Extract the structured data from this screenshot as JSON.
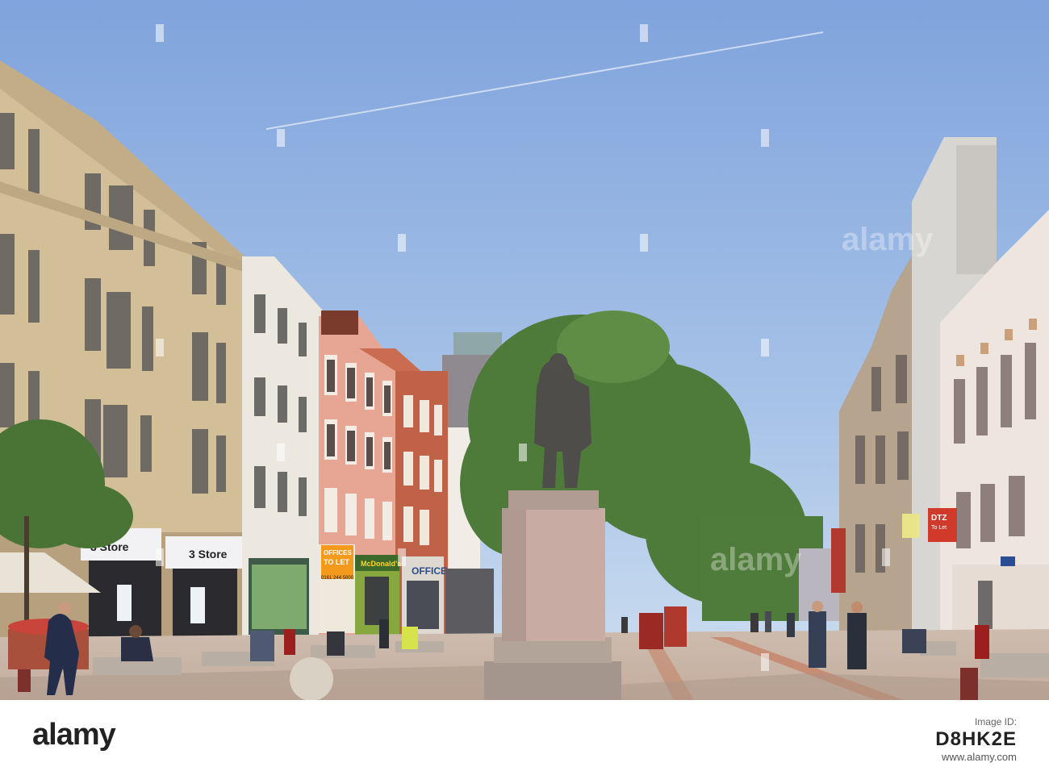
{
  "watermark": {
    "text": "alamy"
  },
  "shop_signs": {
    "three_store_left": "3 Store",
    "three_store_right": "3 Store",
    "to_let_top": "OFFICES",
    "to_let_main": "TO LET",
    "to_let_phone": "0161 244 5000",
    "mcdonalds": "McDonald's",
    "office_shop": "OFFICE",
    "dtz": "DTZ",
    "dtz_sub": "To Let"
  },
  "footer": {
    "logo": "alamy",
    "stock_label": "Image ID:",
    "stock_id": "D8HK2E",
    "url": "www.alamy.com"
  },
  "colors": {
    "sky_top": "#8eaee0",
    "sky_bottom": "#c9dcef",
    "sandstone": "#d4c29e",
    "pavement": "#cbb9a8",
    "tree": "#4f7c3a"
  }
}
